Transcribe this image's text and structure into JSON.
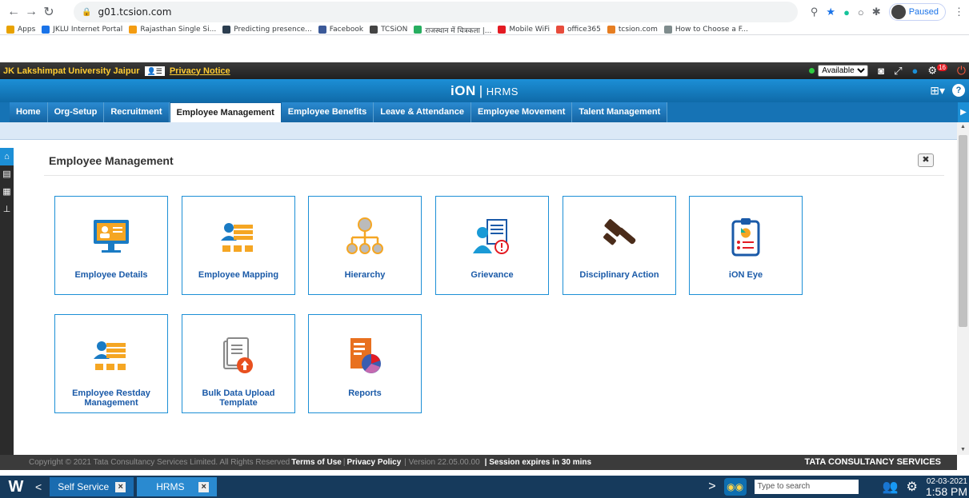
{
  "browser": {
    "url": "g01.tcsion.com",
    "paused_label": "Paused",
    "bookmarks": [
      {
        "label": "Apps",
        "color": "#e8a200"
      },
      {
        "label": "JKLU Internet Portal",
        "color": "#1a73e8"
      },
      {
        "label": "Rajasthan Single Si...",
        "color": "#f39c12"
      },
      {
        "label": "Predicting presence...",
        "color": "#2c3e50"
      },
      {
        "label": "Facebook",
        "color": "#3b5998"
      },
      {
        "label": "TCSiON",
        "color": "#444444"
      },
      {
        "label": "राजस्थान में चित्रकला |...",
        "color": "#27ae60"
      },
      {
        "label": "Mobile WiFi",
        "color": "#e31b23"
      },
      {
        "label": "office365",
        "color": "#e74c3c"
      },
      {
        "label": "tcsion.com",
        "color": "#e67e22"
      },
      {
        "label": "How to Choose a F...",
        "color": "#7f8c8d"
      }
    ]
  },
  "topbar": {
    "university": "JK Lakshimpat University Jaipur",
    "privacy_notice": "Privacy Notice",
    "status_select": "Available",
    "notif_count": "16"
  },
  "brand": {
    "logo": "iON",
    "product": "HRMS"
  },
  "tabs": [
    {
      "label": "Home"
    },
    {
      "label": "Org-Setup"
    },
    {
      "label": "Recruitment"
    },
    {
      "label": "Employee Management"
    },
    {
      "label": "Employee Benefits"
    },
    {
      "label": "Leave & Attendance"
    },
    {
      "label": "Employee Movement"
    },
    {
      "label": "Talent Management"
    }
  ],
  "panel": {
    "title": "Employee Management"
  },
  "tiles": [
    {
      "label": "Employee Details",
      "icon": "employee-details-icon"
    },
    {
      "label": "Employee Mapping",
      "icon": "employee-mapping-icon"
    },
    {
      "label": "Hierarchy",
      "icon": "hierarchy-icon"
    },
    {
      "label": "Grievance",
      "icon": "grievance-icon"
    },
    {
      "label": "Disciplinary Action",
      "icon": "gavel-icon"
    },
    {
      "label": "iON Eye",
      "icon": "clipboard-icon"
    },
    {
      "label": "Employee Restday Management",
      "icon": "employee-restday-icon"
    },
    {
      "label": "Bulk Data Upload Template",
      "icon": "upload-icon"
    },
    {
      "label": "Reports",
      "icon": "reports-icon"
    }
  ],
  "footer": {
    "copyright": "Copyright © 2021 Tata Consultancy Services Limited. All Rights Reserved",
    "terms": "Terms of Use",
    "privacy": "Privacy Policy",
    "version": "| Version 22.05.00.00",
    "session": "| Session expires in 30 mins",
    "tcs": "TATA CONSULTANCY SERVICES"
  },
  "taskbar": {
    "tab1": "Self Service",
    "tab2": "HRMS",
    "search_placeholder": "Type to search",
    "date": "02-03-2021",
    "time": "1:58 PM"
  }
}
